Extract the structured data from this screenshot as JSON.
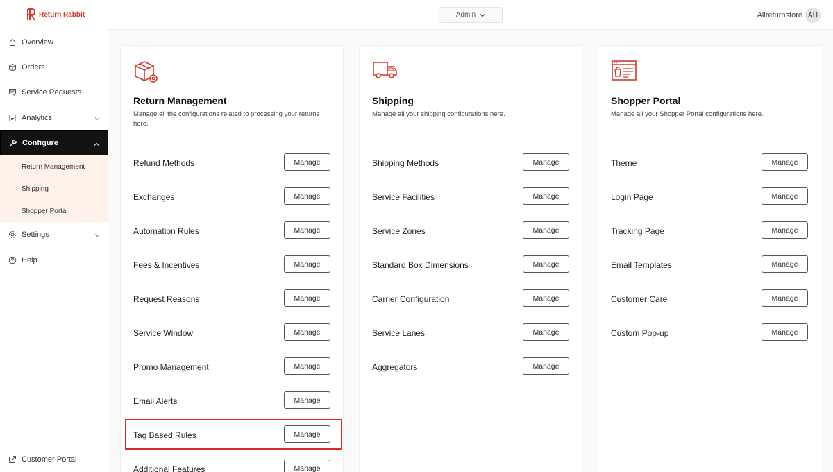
{
  "brand": {
    "name": "Return Rabbit",
    "color": "#d33a2c"
  },
  "sidebar": {
    "items": [
      {
        "label": "Overview",
        "icon": "home-icon"
      },
      {
        "label": "Orders",
        "icon": "box-icon"
      },
      {
        "label": "Service Requests",
        "icon": "requests-icon"
      },
      {
        "label": "Analytics",
        "icon": "analytics-icon"
      },
      {
        "label": "Configure",
        "icon": "wrench-icon"
      },
      {
        "label": "Settings",
        "icon": "gear-icon"
      },
      {
        "label": "Help",
        "icon": "help-icon"
      }
    ],
    "configure_sub": [
      "Return Management",
      "Shipping",
      "Shopper Portal"
    ],
    "footer": {
      "label": "Customer Portal",
      "icon": "external-link-icon"
    }
  },
  "topbar": {
    "role_select": "Admin",
    "store": "Allreturnstore",
    "avatar": "AU"
  },
  "manage_label": "Manage",
  "cards": [
    {
      "title": "Return Management",
      "description": "Manage all the configurations related to processing your returns here.",
      "items": [
        "Refund Methods",
        "Exchanges",
        "Automation Rules",
        "Fees & Incentives",
        "Request Reasons",
        "Service Window",
        "Promo Management",
        "Email Alerts",
        "Tag Based Rules",
        "Additional Features"
      ]
    },
    {
      "title": "Shipping",
      "description": "Manage all your shipping configurations here.",
      "items": [
        "Shipping Methods",
        "Service Facilities",
        "Service Zones",
        "Standard Box Dimensions",
        "Carrier Configuration",
        "Service Lanes",
        "Aggregators"
      ]
    },
    {
      "title": "Shopper Portal",
      "description": "Manage all your Shopper Portal configurations here.",
      "items": [
        "Theme",
        "Login Page",
        "Tracking Page",
        "Email Templates",
        "Customer Care",
        "Custom Pop-up"
      ]
    }
  ],
  "colors": {
    "accent": "#d33a2c",
    "active_nav": "#121212",
    "sub_bg": "#fdf1ea",
    "highlight": "#d8262c"
  }
}
